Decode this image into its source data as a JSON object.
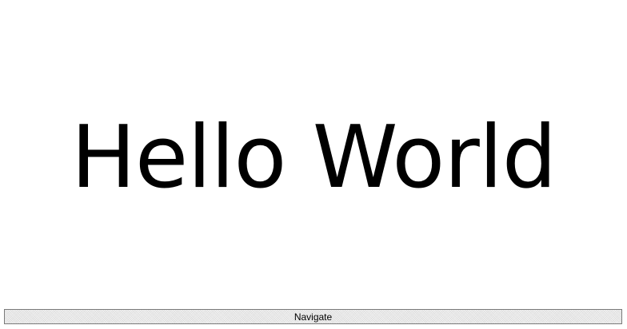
{
  "main": {
    "heading": "Hello World"
  },
  "footer": {
    "navigate_label": "Navigate"
  },
  "colors": {
    "background": "#ffffff",
    "text": "#000000",
    "button_border": "#7a7a7a",
    "button_fill": "#e9e9e9"
  }
}
